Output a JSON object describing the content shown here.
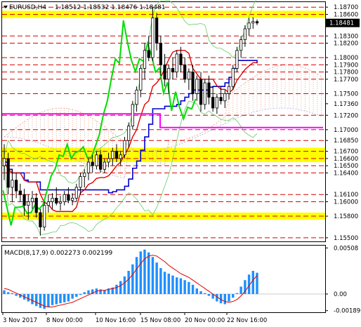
{
  "header": {
    "symbol": "EURUSD,H4",
    "ohlc": "1.18512 1.18532 1.18476 1.18481"
  },
  "macd_panel": {
    "label": "MACD(8,17,9) 0.002273 0.002199",
    "scale_top": "0.00508",
    "scale_zero": "0.00",
    "scale_bottom": "-0.001896"
  },
  "colors": {
    "candle": "#000000",
    "price_line": "#000000",
    "red_dashes": "#d60000",
    "yellow_zone": "#ffff00",
    "tenkan": "#e00000",
    "kijun": "#0000cc",
    "chikou": "#00dd00",
    "bollinger": "#66cc66",
    "magenta_level": "#ff00ff",
    "cloud_red": "#e49a80",
    "cloud_blue": "#9aa8e4",
    "macd_hist": "#1e90ff",
    "macd_signal": "#e00000"
  },
  "chart_data": {
    "type": "candlestick",
    "instrument": "EURUSD",
    "timeframe": "H4",
    "price_ylim": [
      1.1545,
      1.1877
    ],
    "price_ticks": [
      "1.18700",
      "1.18600",
      "1.18300",
      "1.18200",
      "1.18000",
      "1.17900",
      "1.17800",
      "1.17700",
      "1.17500",
      "1.17360",
      "1.17200",
      "1.16850",
      "1.17000",
      "1.16700",
      "1.16600",
      "1.16500",
      "1.16400",
      "1.16100",
      "1.16000",
      "1.15800",
      "1.15500"
    ],
    "current_price": "1.18481",
    "date_labels": [
      "3 Nov 2017",
      "8 Nov 00:00",
      "10 Nov 16:00",
      "15 Nov 08:00",
      "20 Nov 00:00",
      "22 Nov 16:00"
    ],
    "support_resistance_levels": [
      1.187,
      1.186,
      1.183,
      1.182,
      1.18,
      1.179,
      1.178,
      1.177,
      1.175,
      1.172,
      1.17,
      1.1685,
      1.167,
      1.166,
      1.165,
      1.164,
      1.161,
      1.16,
      1.158,
      1.155
    ],
    "yellow_zones": [
      [
        1.1855,
        1.1865
      ],
      [
        1.1655,
        1.1675
      ],
      [
        1.1575,
        1.1585
      ]
    ],
    "magenta_level_values": [
      1.1722,
      1.1703
    ],
    "candles": [
      [
        1.165,
        1.168,
        1.163,
        1.166
      ],
      [
        1.166,
        1.1668,
        1.161,
        1.162
      ],
      [
        1.162,
        1.1645,
        1.16,
        1.163
      ],
      [
        1.163,
        1.164,
        1.1605,
        1.1615
      ],
      [
        1.1615,
        1.1625,
        1.16,
        1.161
      ],
      [
        1.161,
        1.1618,
        1.158,
        1.1595
      ],
      [
        1.1595,
        1.161,
        1.1575,
        1.16
      ],
      [
        1.16,
        1.1615,
        1.159,
        1.1605
      ],
      [
        1.1605,
        1.1612,
        1.1578,
        1.1585
      ],
      [
        1.1585,
        1.159,
        1.1553,
        1.1565
      ],
      [
        1.1565,
        1.16,
        1.156,
        1.1595
      ],
      [
        1.1595,
        1.161,
        1.1585,
        1.16
      ],
      [
        1.16,
        1.1612,
        1.159,
        1.1605
      ],
      [
        1.1605,
        1.162,
        1.1595,
        1.1598
      ],
      [
        1.1598,
        1.1608,
        1.1588,
        1.16
      ],
      [
        1.16,
        1.1615,
        1.1595,
        1.161
      ],
      [
        1.161,
        1.162,
        1.1598,
        1.1602
      ],
      [
        1.1602,
        1.1612,
        1.1595,
        1.1605
      ],
      [
        1.1605,
        1.1625,
        1.16,
        1.162
      ],
      [
        1.162,
        1.164,
        1.161,
        1.1635
      ],
      [
        1.1635,
        1.1645,
        1.162,
        1.164
      ],
      [
        1.164,
        1.166,
        1.163,
        1.1655
      ],
      [
        1.1655,
        1.1665,
        1.164,
        1.165
      ],
      [
        1.165,
        1.167,
        1.1645,
        1.1665
      ],
      [
        1.1665,
        1.1672,
        1.164,
        1.1645
      ],
      [
        1.1645,
        1.166,
        1.164,
        1.1655
      ],
      [
        1.1655,
        1.1668,
        1.1648,
        1.166
      ],
      [
        1.166,
        1.1675,
        1.165,
        1.167
      ],
      [
        1.167,
        1.168,
        1.1655,
        1.166
      ],
      [
        1.166,
        1.167,
        1.165,
        1.1665
      ],
      [
        1.1665,
        1.169,
        1.166,
        1.1685
      ],
      [
        1.1685,
        1.171,
        1.1675,
        1.1705
      ],
      [
        1.1705,
        1.174,
        1.17,
        1.1735
      ],
      [
        1.1735,
        1.176,
        1.1725,
        1.1755
      ],
      [
        1.1755,
        1.179,
        1.1745,
        1.1785
      ],
      [
        1.1785,
        1.182,
        1.177,
        1.181
      ],
      [
        1.181,
        1.183,
        1.1795,
        1.18
      ],
      [
        1.18,
        1.187,
        1.1795,
        1.1855
      ],
      [
        1.1855,
        1.1862,
        1.181,
        1.182
      ],
      [
        1.182,
        1.183,
        1.1775,
        1.179
      ],
      [
        1.179,
        1.1805,
        1.176,
        1.177
      ],
      [
        1.177,
        1.179,
        1.175,
        1.1785
      ],
      [
        1.1785,
        1.18,
        1.177,
        1.178
      ],
      [
        1.178,
        1.181,
        1.1772,
        1.1805
      ],
      [
        1.1805,
        1.1815,
        1.178,
        1.179
      ],
      [
        1.179,
        1.18,
        1.1765,
        1.177
      ],
      [
        1.177,
        1.1785,
        1.1755,
        1.178
      ],
      [
        1.178,
        1.179,
        1.174,
        1.175
      ],
      [
        1.175,
        1.1775,
        1.174,
        1.177
      ],
      [
        1.177,
        1.178,
        1.1725,
        1.1735
      ],
      [
        1.1735,
        1.177,
        1.1728,
        1.1765
      ],
      [
        1.1765,
        1.1775,
        1.1735,
        1.1745
      ],
      [
        1.1745,
        1.176,
        1.1725,
        1.173
      ],
      [
        1.173,
        1.175,
        1.1722,
        1.1745
      ],
      [
        1.1745,
        1.176,
        1.1735,
        1.174
      ],
      [
        1.174,
        1.1755,
        1.173,
        1.175
      ],
      [
        1.175,
        1.1765,
        1.1742,
        1.176
      ],
      [
        1.176,
        1.179,
        1.1755,
        1.1785
      ],
      [
        1.1785,
        1.1815,
        1.178,
        1.181
      ],
      [
        1.181,
        1.183,
        1.18,
        1.1825
      ],
      [
        1.1825,
        1.1845,
        1.1815,
        1.184
      ],
      [
        1.184,
        1.1855,
        1.183,
        1.1848
      ],
      [
        1.1848,
        1.1856,
        1.184,
        1.185
      ],
      [
        1.185,
        1.1853,
        1.1845,
        1.1848
      ]
    ],
    "macd_histogram": [
      0.0004,
      0.0002,
      0.0001,
      -0.0002,
      -0.0004,
      -0.0006,
      -0.0008,
      -0.0011,
      -0.0013,
      -0.0015,
      -0.0016,
      -0.0014,
      -0.0012,
      -0.0011,
      -0.001,
      -0.0009,
      -0.0008,
      -0.0005,
      -0.0003,
      -0.0001,
      0.0002,
      0.0004,
      0.0005,
      0.0006,
      0.0005,
      0.0004,
      0.0006,
      0.0007,
      0.001,
      0.0014,
      0.0019,
      0.0025,
      0.0032,
      0.004,
      0.0046,
      0.0048,
      0.0045,
      0.004,
      0.0034,
      0.0028,
      0.0024,
      0.0022,
      0.002,
      0.0018,
      0.0017,
      0.0015,
      0.0013,
      0.001,
      0.0006,
      0.0003,
      0.0001,
      -0.0002,
      -0.0005,
      -0.0008,
      -0.001,
      -0.0011,
      -0.0008,
      -0.0004,
      0.0001,
      0.0008,
      0.0015,
      0.0021,
      0.0025,
      0.0023
    ],
    "macd_signal": [
      0.0006,
      0.0005,
      0.0003,
      0.0001,
      -0.0001,
      -0.0003,
      -0.0005,
      -0.0007,
      -0.0009,
      -0.0011,
      -0.0013,
      -0.0014,
      -0.0014,
      -0.0013,
      -0.0012,
      -0.0011,
      -0.001,
      -0.0009,
      -0.0007,
      -0.0005,
      -0.0003,
      -0.0001,
      0.0001,
      0.0003,
      0.0004,
      0.0004,
      0.0005,
      0.0006,
      0.0007,
      0.0009,
      0.0012,
      0.0016,
      0.0021,
      0.0027,
      0.0033,
      0.0038,
      0.0041,
      0.0042,
      0.0041,
      0.0038,
      0.0035,
      0.0031,
      0.0028,
      0.0025,
      0.0022,
      0.002,
      0.0018,
      0.0015,
      0.0012,
      0.0009,
      0.0006,
      0.0003,
      0.0,
      -0.0003,
      -0.0006,
      -0.0008,
      -0.0009,
      -0.0008,
      -0.0006,
      -0.0002,
      0.0003,
      0.0009,
      0.0015,
      0.002
    ],
    "macd_ylim": [
      -0.001896,
      0.00508
    ]
  }
}
